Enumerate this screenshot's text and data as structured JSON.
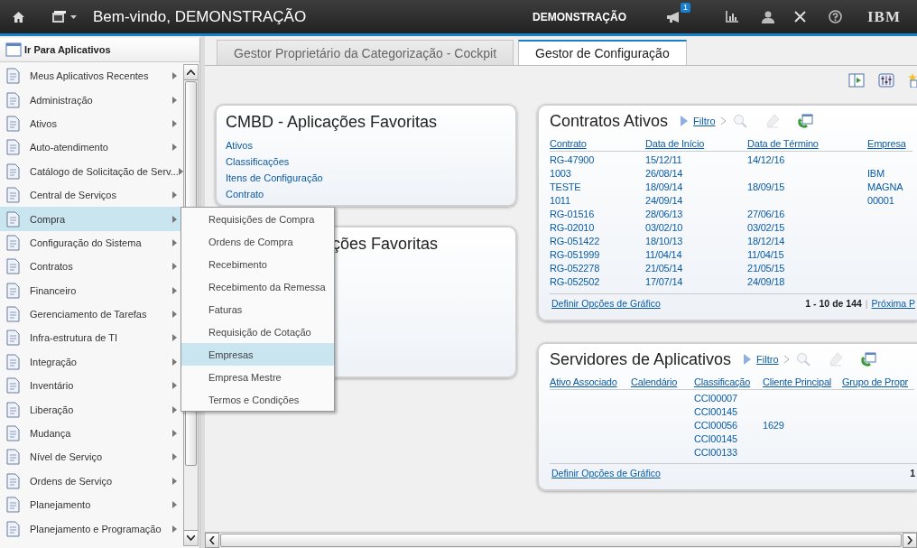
{
  "header": {
    "title": "Bem-vindo, DEMONSTRAÇÃO",
    "user": "DEMONSTRAÇÃO",
    "notification_count": "1",
    "logo": "IBM"
  },
  "sidebar": {
    "title": "Ir Para Aplicativos",
    "items": [
      {
        "label": "Meus Aplicativos Recentes",
        "selected": false
      },
      {
        "label": "Administração",
        "selected": false
      },
      {
        "label": "Ativos",
        "selected": false
      },
      {
        "label": "Auto-atendimento",
        "selected": false
      },
      {
        "label": "Catálogo de Solicitação de Serv...",
        "selected": false
      },
      {
        "label": "Central de Serviços",
        "selected": false
      },
      {
        "label": "Compra",
        "selected": true
      },
      {
        "label": "Configuração do Sistema",
        "selected": false
      },
      {
        "label": "Contratos",
        "selected": false
      },
      {
        "label": "Financeiro",
        "selected": false
      },
      {
        "label": "Gerenciamento de Tarefas",
        "selected": false
      },
      {
        "label": "Infra-estrutura de TI",
        "selected": false
      },
      {
        "label": "Integração",
        "selected": false
      },
      {
        "label": "Inventário",
        "selected": false
      },
      {
        "label": "Liberação",
        "selected": false
      },
      {
        "label": "Mudança",
        "selected": false
      },
      {
        "label": "Nível de Serviço",
        "selected": false
      },
      {
        "label": "Ordens de Serviço",
        "selected": false
      },
      {
        "label": "Planejamento",
        "selected": false
      },
      {
        "label": "Planejamento e Programação",
        "selected": false
      }
    ]
  },
  "submenu": {
    "items": [
      {
        "label": "Requisições de Compra",
        "selected": false
      },
      {
        "label": "Ordens de Compra",
        "selected": false
      },
      {
        "label": "Recebimento",
        "selected": false
      },
      {
        "label": "Recebimento da Remessa",
        "selected": false
      },
      {
        "label": "Faturas",
        "selected": false
      },
      {
        "label": "Requisição de Cotação",
        "selected": false
      },
      {
        "label": "Empresas",
        "selected": true
      },
      {
        "label": "Empresa Mestre",
        "selected": false
      },
      {
        "label": "Termos e Condições",
        "selected": false
      }
    ]
  },
  "tabs": [
    {
      "label": "Gestor Proprietário da Categorização - Cockpit",
      "selected": false
    },
    {
      "label": "Gestor de Configuração",
      "selected": true
    }
  ],
  "favorites_card": {
    "title": "CMBD - Aplicações Favoritas",
    "links": [
      "Ativos",
      "Classificações",
      "Itens de Configuração",
      "Contrato"
    ]
  },
  "second_card": {
    "title": "ções Favoritas"
  },
  "contracts_card": {
    "title": "Contratos Ativos",
    "filter": "Filtro",
    "columns": [
      "Contrato",
      "Data de Início",
      "Data de Término",
      "Empresa"
    ],
    "rows": [
      [
        "RG-47900",
        "15/12/11",
        "14/12/16",
        null
      ],
      [
        "1003",
        "26/08/14",
        null,
        "IBM"
      ],
      [
        "TESTE",
        "18/09/14",
        "18/09/15",
        "MAGNA"
      ],
      [
        "1011",
        "24/09/14",
        null,
        "00001"
      ],
      [
        "RG-01516",
        "28/06/13",
        "27/06/16",
        null
      ],
      [
        "RG-02010",
        "03/02/10",
        "03/02/15",
        null
      ],
      [
        "RG-051422",
        "18/10/13",
        "18/12/14",
        null
      ],
      [
        "RG-051999",
        "11/04/14",
        "11/04/15",
        null
      ],
      [
        "RG-052278",
        "21/05/14",
        "21/05/15",
        null
      ],
      [
        "RG-052502",
        "17/07/14",
        "24/09/18",
        null
      ]
    ],
    "footer_link": "Definir Opções de Gráfico",
    "page_info": "1 - 10 de 144",
    "separator": "|",
    "next_link": "Próxima P"
  },
  "servers_card": {
    "title": "Servidores de Aplicativos",
    "filter": "Filtro",
    "columns": [
      "Ativo Associado",
      "Calendário",
      "Classificação",
      "Cliente Principal",
      "Grupo de Propr"
    ],
    "rows": [
      [
        null,
        null,
        "CCI00007",
        null,
        null
      ],
      [
        null,
        null,
        "CCI00145",
        null,
        null
      ],
      [
        null,
        null,
        "CCI00056",
        "1629",
        null
      ],
      [
        null,
        null,
        "CCI00145",
        null,
        null
      ],
      [
        null,
        null,
        "CCI00133",
        null,
        null
      ]
    ],
    "footer_link": "Definir Opções de Gráfico",
    "page_info": "1"
  }
}
